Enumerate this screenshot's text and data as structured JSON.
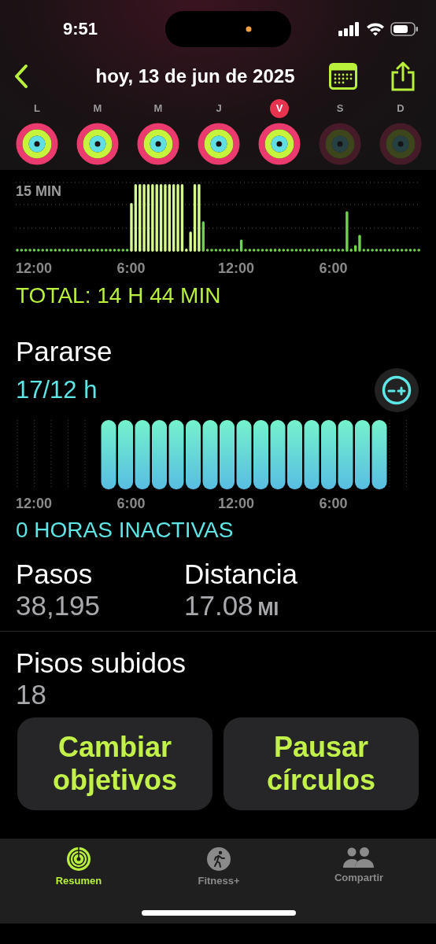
{
  "status_bar": {
    "time": "9:51"
  },
  "header": {
    "title": "hoy, 13 de jun de 2025"
  },
  "week": [
    {
      "letter": "L",
      "selected": false,
      "dimmed": false
    },
    {
      "letter": "M",
      "selected": false,
      "dimmed": false
    },
    {
      "letter": "M",
      "selected": false,
      "dimmed": false
    },
    {
      "letter": "J",
      "selected": false,
      "dimmed": false
    },
    {
      "letter": "V",
      "selected": true,
      "dimmed": false
    },
    {
      "letter": "S",
      "selected": false,
      "dimmed": true
    },
    {
      "letter": "D",
      "selected": false,
      "dimmed": true
    }
  ],
  "exercise": {
    "gridline_label": "15 MIN",
    "x_labels": [
      "12:00",
      "6:00",
      "12:00",
      "6:00"
    ],
    "total": "TOTAL: 14 H 44 MIN"
  },
  "stand": {
    "title": "Pararse",
    "value": "17/12 h",
    "x_labels": [
      "12:00",
      "6:00",
      "12:00",
      "6:00"
    ],
    "summary": "0 HORAS INACTIVAS"
  },
  "stats": [
    {
      "label": "Pasos",
      "value": "38,195"
    },
    {
      "label": "Distancia",
      "value": "17.08",
      "unit": "MI"
    }
  ],
  "floors": {
    "label": "Pisos subidos",
    "value": "18"
  },
  "actions": [
    {
      "label": "Cambiar objetivos"
    },
    {
      "label": "Pausar círculos"
    }
  ],
  "tabs": [
    {
      "label": "Resumen",
      "selected": true,
      "kind": "rings"
    },
    {
      "label": "Fitness+",
      "selected": false,
      "kind": "runner"
    },
    {
      "label": "Compartir",
      "selected": false,
      "kind": "people"
    }
  ]
}
